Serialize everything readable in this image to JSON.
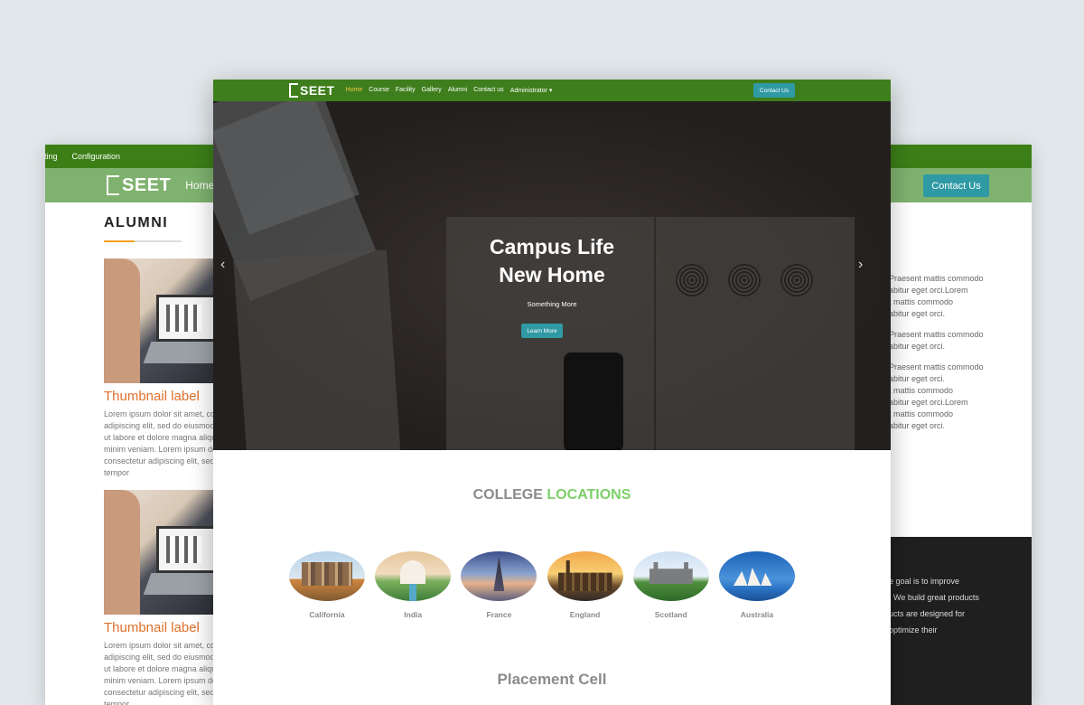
{
  "brand": {
    "logo_text": "SEET"
  },
  "left_window": {
    "topbar": [
      "rting",
      "Configuration"
    ],
    "nav_home": "Home",
    "section_title": "ALUMNI",
    "thumbnails": [
      {
        "label": "Thumbnail label",
        "text": [
          "Lorem ipsum dolor sit amet, co",
          "adipiscing elit, sed do eiusmod",
          "ut labore et dolore magna aliqu",
          "minim veniam. Lorem ipsum do",
          "consectetur adipiscing elit, sed",
          "tempor"
        ]
      },
      {
        "label": "Thumbnail label",
        "text": [
          "Lorem ipsum dolor sit amet, co",
          "adipiscing elit, sed do eiusmod",
          "ut labore et dolore magna aliqu",
          "minim veniam. Lorem ipsum do",
          "consectetur adipiscing elit, sed",
          "tempor"
        ]
      }
    ]
  },
  "right_window": {
    "contact_button": "Contact Us",
    "paragraphs": [
      [
        "Praesent mattis commodo",
        "abitur eget orci.Lorem",
        "t mattis commodo",
        "abitur eget orci."
      ],
      [
        "Praesent mattis commodo",
        "abitur eget orci."
      ],
      [
        "Praesent mattis commodo",
        "abitur eget orci.",
        "t mattis commodo",
        "abitur eget orci.Lorem",
        "t mattis commodo",
        "abitur eget orci."
      ]
    ],
    "footer": [
      "e goal is to improve",
      ". We build great products",
      "ucts are designed for",
      "optimize their"
    ]
  },
  "main_window": {
    "nav_links": [
      {
        "label": "Home",
        "active": true
      },
      {
        "label": "Course",
        "active": false
      },
      {
        "label": "Facility",
        "active": false
      },
      {
        "label": "Gallery",
        "active": false
      },
      {
        "label": "Alumni",
        "active": false
      },
      {
        "label": "Contact us",
        "active": false
      },
      {
        "label": "Administrator ▾",
        "active": false
      }
    ],
    "contact_button": "Contact Us",
    "hero": {
      "title_line1": "Campus Life",
      "title_line2": "New Home",
      "subtitle": "Something More",
      "button": "Learn More",
      "prev_arrow": "‹",
      "next_arrow": "›"
    },
    "locations_title_part1": "COLLEGE",
    "locations_title_part2": "LOCATIONS",
    "locations": [
      "California",
      "India",
      "France",
      "England",
      "Scotland",
      "Australia"
    ],
    "placement_title": "Placement Cell"
  },
  "colors": {
    "topbar_green": "#3c7f17",
    "nav_light_green": "#7fb26f",
    "teal_button": "#2f9aa4",
    "accent_green_text": "#7dd06a",
    "thumbnail_label_orange": "#e0702a",
    "background": "#e1e7ea"
  }
}
